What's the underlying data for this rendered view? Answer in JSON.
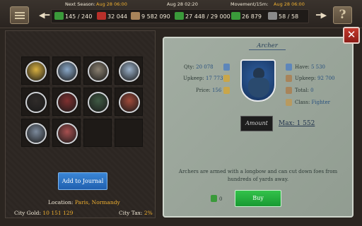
{
  "top": {
    "next_season_label": "Next Season:",
    "next_season_date": "Aug 28 06:00",
    "current_date": "Aug 28 02:20",
    "movement_label": "Movement/15m:",
    "movement_date": "Aug 28 06:00",
    "stats": {
      "troops": "145 / 240",
      "strength": "32 044",
      "gold": "9 582 090",
      "food": "27 448 / 29 000",
      "recruits": "26 879",
      "castles": "58 / 58"
    }
  },
  "grid": {
    "units": [
      {
        "name": "unit-peasant",
        "color": "#d8b040"
      },
      {
        "name": "unit-swordsman",
        "color": "#8aa8c8"
      },
      {
        "name": "unit-spearman",
        "color": "#8a8070"
      },
      {
        "name": "unit-knight",
        "color": "#9ab0c8"
      },
      {
        "name": "unit-dark-hood",
        "color": "#302c2a"
      },
      {
        "name": "unit-red-hood",
        "color": "#803030"
      },
      {
        "name": "unit-green-hood",
        "color": "#3f5a44"
      },
      {
        "name": "unit-crossbow",
        "color": "#a04a3a"
      },
      {
        "name": "unit-cavalry",
        "color": "#7c8a9c"
      },
      {
        "name": "unit-heavy-cavalry",
        "color": "#a85050"
      }
    ]
  },
  "left": {
    "add_journal": "Add to Journal",
    "location_label": "Location:",
    "location_value": "Paris, Normandy",
    "city_gold_label": "City Gold:",
    "city_gold_value": "10 151 129",
    "city_tax_label": "City Tax:",
    "city_tax_value": "2%"
  },
  "unit": {
    "title": "Archer",
    "qty_label": "Qty:",
    "qty_value": "20 078",
    "upkeep_label": "Upkeep:",
    "upkeep_value": "17 773",
    "price_label": "Price:",
    "price_value": "156",
    "have_label": "Have:",
    "have_value": "5 530",
    "total_upkeep_label": "Upkeep:",
    "total_upkeep_value": "92 700",
    "total_label": "Total:",
    "total_value": "0",
    "class_label": "Class:",
    "class_value": "Fighter",
    "amount_placeholder": "Amount",
    "max_label": "Max: 1 552",
    "description": "Archers are armed with a longbow and can cut down foes from hundreds of yards away.",
    "cost_value": "0",
    "buy_label": "Buy"
  },
  "colors": {
    "highlight": "#f0b030",
    "panel": "#9aa69a",
    "buy": "#22ad3c",
    "journal": "#2f7ad0",
    "close": "#b0302a"
  }
}
